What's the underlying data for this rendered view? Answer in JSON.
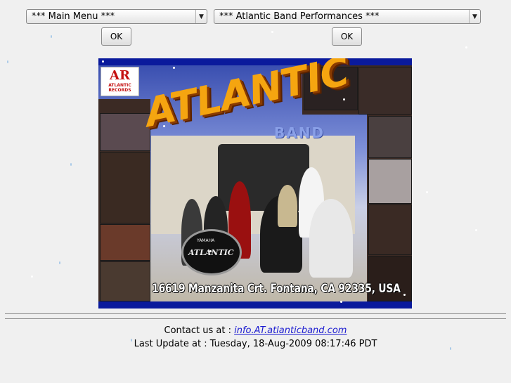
{
  "main_menu": {
    "selected": "*** Main Menu ***",
    "ok_label": "OK"
  },
  "performances_menu": {
    "selected": "*** Atlantic Band Performances ***",
    "ok_label": "OK"
  },
  "poster": {
    "headline": "ATLANTIC",
    "subheadline": "BAND",
    "logo_mark": "AR",
    "logo_text_1": "ATLANTIC",
    "logo_text_2": "RECORDS",
    "drum_brand": "YAMAHA",
    "drum_text": "ATLANTIC",
    "address": "16619 Manzanita Crt. Fontana, CA 92335, USA"
  },
  "footer": {
    "contact_prefix": "Contact  us  at   :",
    "contact_email": "info.AT.atlanticband.com",
    "update_prefix": "Last Update at  :",
    "update_value": "Tuesday, 18-Aug-2009 08:17:46 PDT"
  },
  "icons": {
    "dropdown": "chevron-down-icon"
  }
}
